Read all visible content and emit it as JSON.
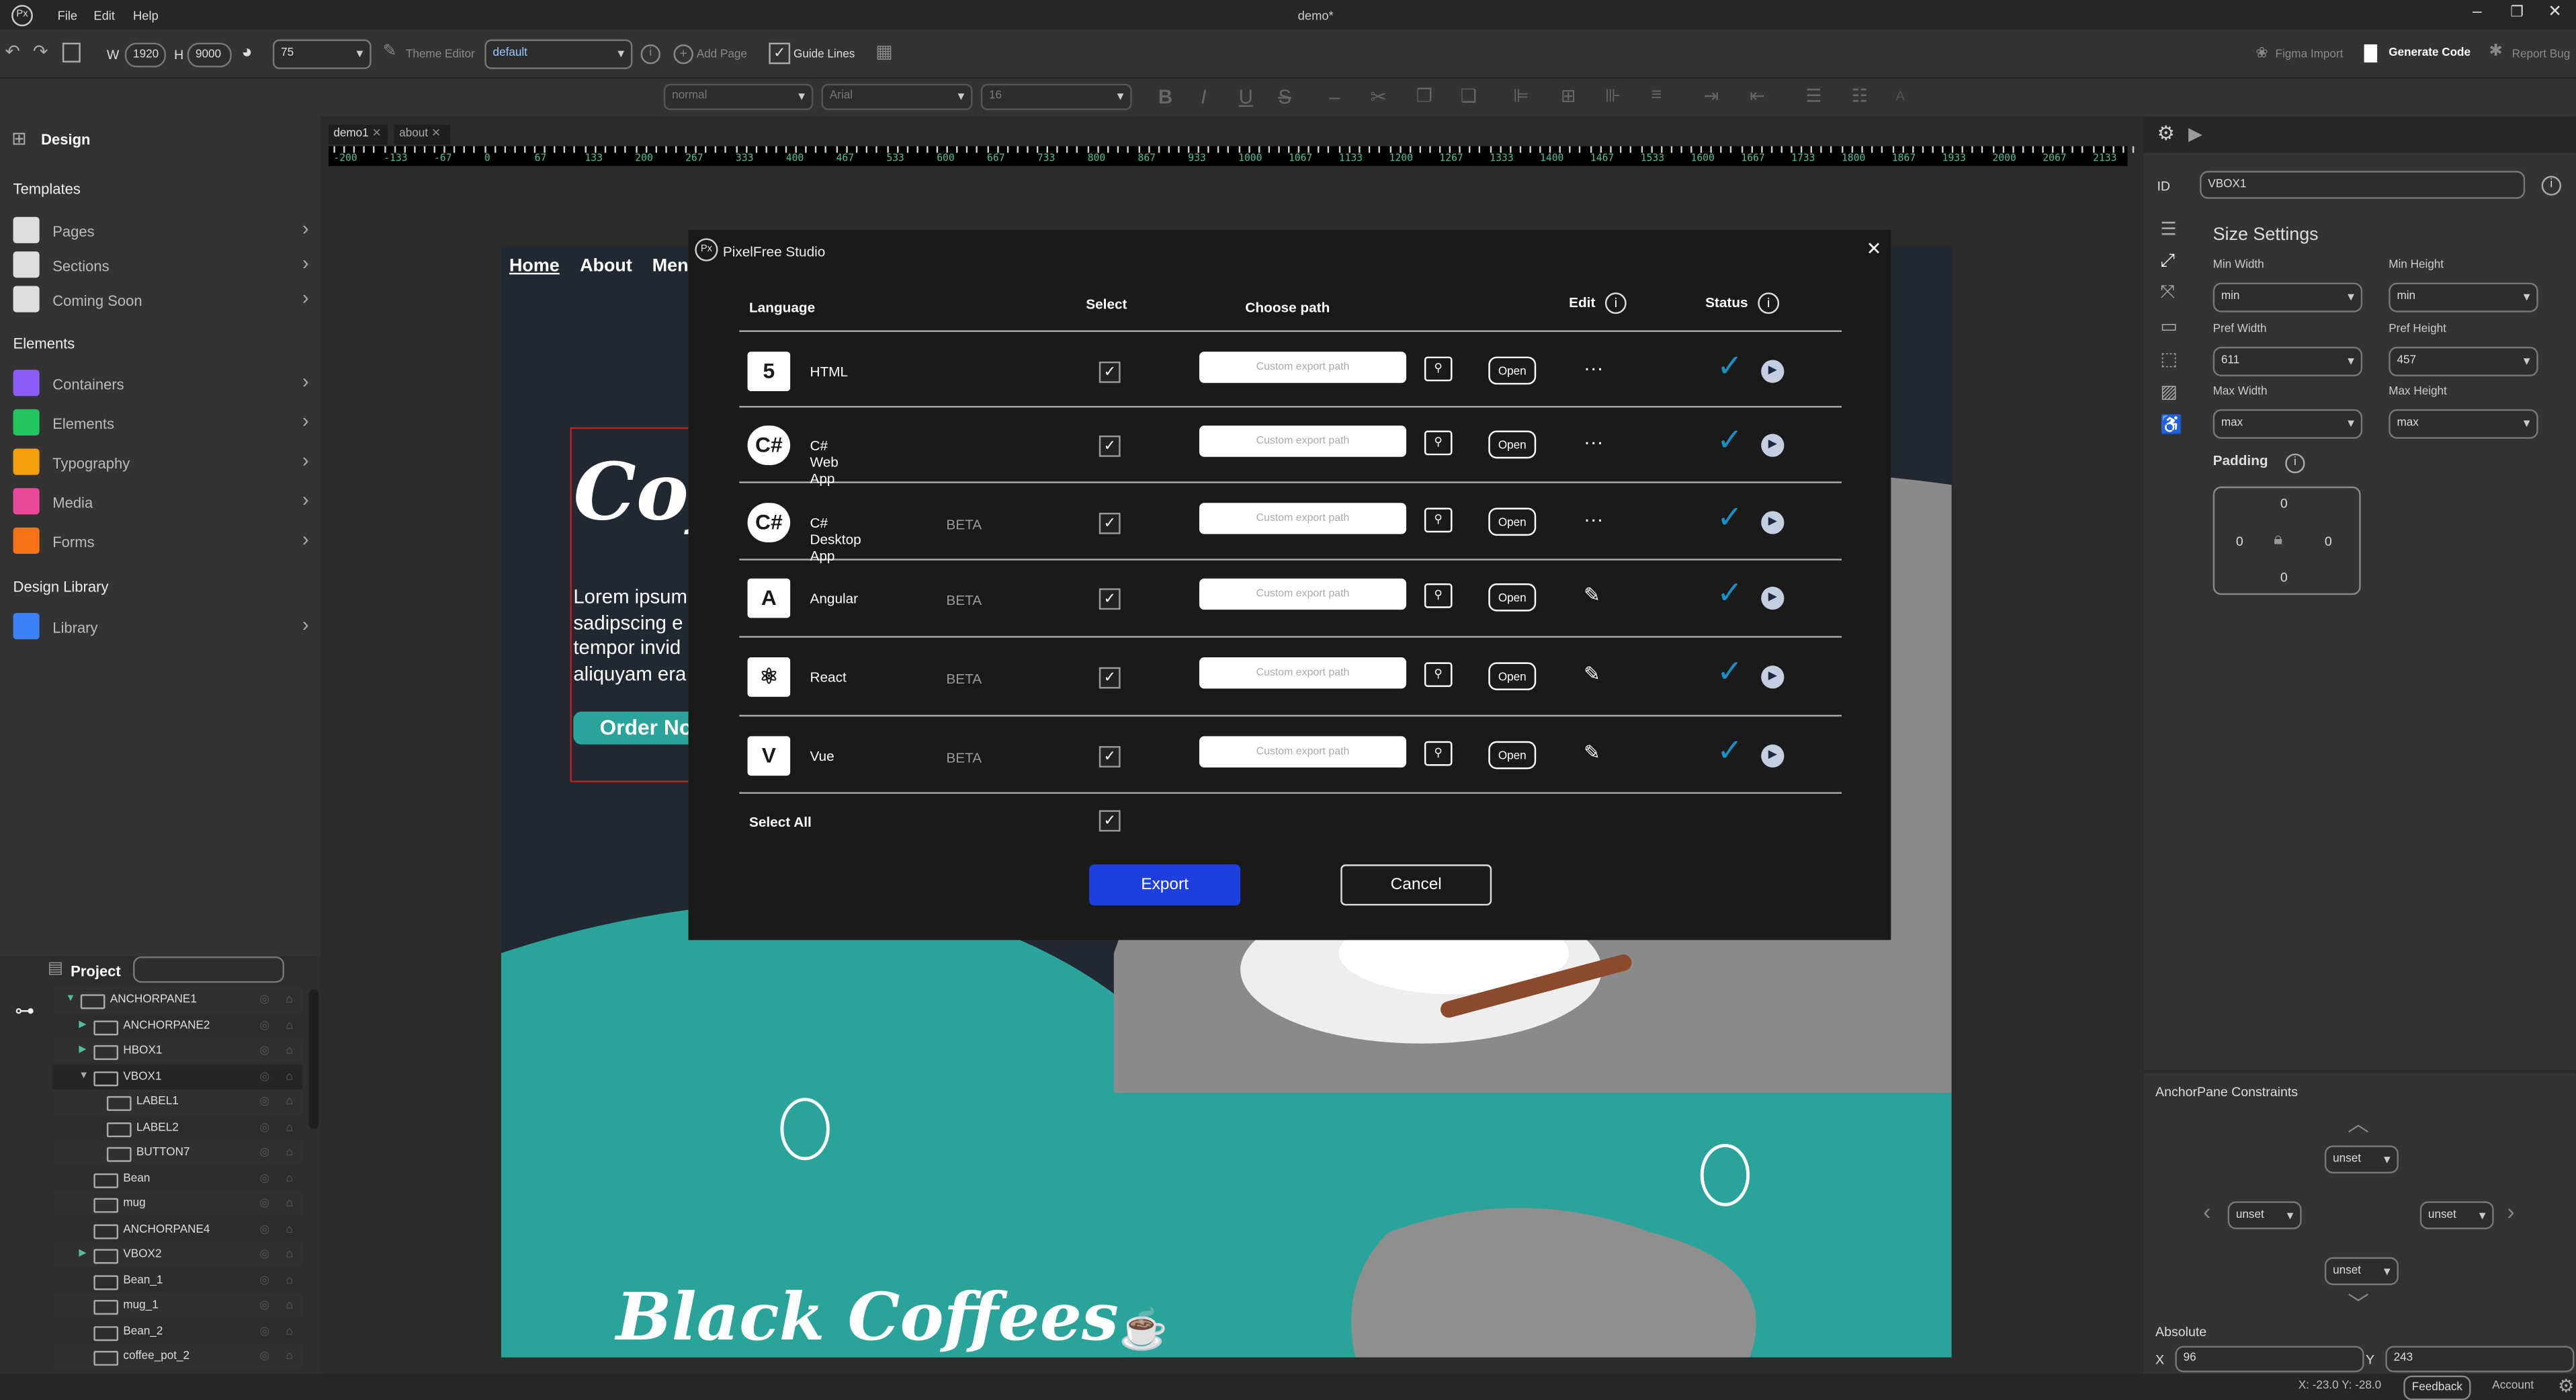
{
  "app": {
    "title": "demo*",
    "menu": [
      "File",
      "Edit",
      "Help"
    ]
  },
  "toolbar": {
    "w_label": "W",
    "width": "1920",
    "h_label": "H",
    "height": "9000",
    "zoom": "75",
    "theme_editor": "Theme Editor",
    "theme": "default",
    "add_page": "Add Page",
    "guide_lines": "Guide Lines",
    "figma_import": "Figma Import",
    "generate_code": "Generate Code",
    "report_bug": "Report Bug"
  },
  "format": {
    "weight": "normal",
    "font": "Arial",
    "size": "16",
    "bold": "B",
    "italic": "I",
    "underline": "U",
    "strike": "S",
    "font_color": "A"
  },
  "left": {
    "design": "Design",
    "templates": "Templates",
    "template_items": [
      {
        "label": "Pages",
        "color": "#ddd"
      },
      {
        "label": "Sections",
        "color": "#ddd"
      },
      {
        "label": "Coming Soon",
        "color": "#ddd"
      }
    ],
    "elements": "Elements",
    "element_items": [
      {
        "label": "Containers",
        "color": "#8b5cf6"
      },
      {
        "label": "Elements",
        "color": "#22c55e"
      },
      {
        "label": "Typography",
        "color": "#f59e0b"
      },
      {
        "label": "Media",
        "color": "#ec4899"
      },
      {
        "label": "Forms",
        "color": "#f97316"
      }
    ],
    "design_library": "Design Library",
    "library_items": [
      {
        "label": "Library",
        "color": "#3b82f6"
      }
    ]
  },
  "project": {
    "title": "Project",
    "search": "",
    "tree": [
      {
        "label": "ANCHORPANE1",
        "depth": 0,
        "arrow": "down-green",
        "icon": "grid"
      },
      {
        "label": "ANCHORPANE2",
        "depth": 1,
        "arrow": "right-green",
        "icon": "grid"
      },
      {
        "label": "HBOX1",
        "depth": 1,
        "arrow": "right-green",
        "icon": "hbox"
      },
      {
        "label": "VBOX1",
        "depth": 1,
        "arrow": "down-gray",
        "icon": "vbox",
        "selected": true
      },
      {
        "label": "LABEL1",
        "depth": 2,
        "arrow": "",
        "icon": "tag"
      },
      {
        "label": "LABEL2",
        "depth": 2,
        "arrow": "",
        "icon": "tag"
      },
      {
        "label": "BUTTON7",
        "depth": 2,
        "arrow": "",
        "icon": "button"
      },
      {
        "label": "Bean",
        "depth": 1,
        "arrow": "",
        "icon": "grid"
      },
      {
        "label": "mug",
        "depth": 1,
        "arrow": "",
        "icon": "grid"
      },
      {
        "label": "ANCHORPANE4",
        "depth": 1,
        "arrow": "",
        "icon": "grid"
      },
      {
        "label": "VBOX2",
        "depth": 1,
        "arrow": "right-green",
        "icon": "vbox"
      },
      {
        "label": "Bean_1",
        "depth": 1,
        "arrow": "",
        "icon": "grid"
      },
      {
        "label": "mug_1",
        "depth": 1,
        "arrow": "",
        "icon": "grid"
      },
      {
        "label": "Bean_2",
        "depth": 1,
        "arrow": "",
        "icon": "grid"
      },
      {
        "label": "coffee_pot_2",
        "depth": 1,
        "arrow": "",
        "icon": "grid"
      }
    ]
  },
  "tabs": [
    "demo1",
    "about"
  ],
  "ruler": [
    "-200",
    "-133",
    "-67",
    "0",
    "67",
    "133",
    "200",
    "267",
    "333",
    "400",
    "467",
    "533",
    "600",
    "667",
    "733",
    "800",
    "867",
    "933",
    "1000",
    "1067",
    "1133",
    "1200",
    "1267",
    "1333",
    "1400",
    "1467",
    "1533",
    "1600",
    "1667",
    "1733",
    "1800",
    "1867",
    "1933",
    "2000",
    "2067",
    "2133"
  ],
  "canvas": {
    "nav": [
      "Home",
      "About",
      "Menu"
    ],
    "hero_title": "Coffee",
    "hero_text": [
      "Lorem ipsum",
      "sadipscing e",
      "tempor invid",
      "aliquyam era"
    ],
    "order_button": "Order Now",
    "section_title": "Black Coffees",
    "colors": {
      "dark": "#222831",
      "teal": "#2aa39a"
    }
  },
  "dialog": {
    "title": "PixelFree Studio",
    "headers": {
      "language": "Language",
      "select": "Select",
      "path": "Choose path",
      "edit": "Edit",
      "status": "Status"
    },
    "rows": [
      {
        "name": "HTML",
        "beta": "",
        "icon": "html5-icon",
        "glyph": "5",
        "edit": "more"
      },
      {
        "name": "C# Web App",
        "beta": "",
        "icon": "csharp-icon",
        "glyph": "C#",
        "edit": "more"
      },
      {
        "name": "C# Desktop App",
        "beta": "BETA",
        "icon": "csharp-icon",
        "glyph": "C#",
        "edit": "more"
      },
      {
        "name": "Angular",
        "beta": "BETA",
        "icon": "angular-icon",
        "glyph": "A",
        "edit": "pencil"
      },
      {
        "name": "React",
        "beta": "BETA",
        "icon": "react-icon",
        "glyph": "⚛",
        "edit": "pencil"
      },
      {
        "name": "Vue",
        "beta": "BETA",
        "icon": "vue-icon",
        "glyph": "V",
        "edit": "pencil"
      }
    ],
    "path_placeholder": "Custom export path",
    "open": "Open",
    "select_all": "Select All",
    "export": "Export",
    "cancel": "Cancel",
    "export_color": "#1d3fe0",
    "status_color": "#1a8fc4"
  },
  "right": {
    "id_label": "ID",
    "id_value": "VBOX1",
    "size_settings": "Size Settings",
    "fields": [
      {
        "label": "Min Width",
        "value": "min"
      },
      {
        "label": "Min Height",
        "value": "min"
      },
      {
        "label": "Pref Width",
        "value": "611"
      },
      {
        "label": "Pref Height",
        "value": "457"
      },
      {
        "label": "Max Width",
        "value": "max"
      },
      {
        "label": "Max Height",
        "value": "max"
      }
    ],
    "padding": "Padding",
    "pad": {
      "top": "0",
      "left": "0",
      "right": "0",
      "bottom": "0"
    },
    "anchor_title": "AnchorPane Constraints",
    "anchor": {
      "top": "unset",
      "left": "unset",
      "right": "unset",
      "bottom": "unset"
    },
    "absolute": "Absolute",
    "x_label": "X",
    "x": "96",
    "y_label": "Y",
    "y": "243"
  },
  "status": {
    "coords": "X: -23.0 Y: -28.0",
    "feedback": "Feedback",
    "account": "Account"
  }
}
